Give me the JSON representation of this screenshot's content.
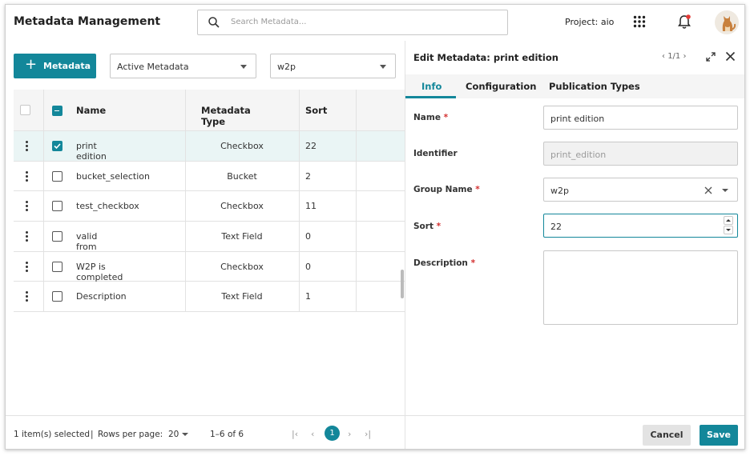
{
  "header": {
    "title": "Metadata Management",
    "search_placeholder": "Search Metadata...",
    "project": "Project: aio"
  },
  "toolbar": {
    "add_label": "Metadata",
    "filter_select": "Active Metadata",
    "group_select": "w2p"
  },
  "table": {
    "columns": [
      "Name",
      "Metadata Type",
      "Sort"
    ],
    "rows": [
      {
        "name": "print edition",
        "type": "Checkbox",
        "sort": "22",
        "checked": true
      },
      {
        "name": "bucket_selection",
        "type": "Bucket",
        "sort": "2",
        "checked": false
      },
      {
        "name": "test_checkbox",
        "type": "Checkbox",
        "sort": "11",
        "checked": false
      },
      {
        "name": "valid from",
        "type": "Text Field",
        "sort": "0",
        "checked": false
      },
      {
        "name": "W2P is completed",
        "type": "Checkbox",
        "sort": "0",
        "checked": false
      },
      {
        "name": "Description",
        "type": "Text Field",
        "sort": "1",
        "checked": false
      }
    ]
  },
  "footer": {
    "selected": "1 item(s) selected",
    "rows_per_page_label": "Rows per page:",
    "rows_per_page": "20",
    "range": "1–6 of 6",
    "page": "1"
  },
  "panel": {
    "title": "Edit Metadata: print edition",
    "nav": "1/1",
    "tabs": [
      "Info",
      "Configuration",
      "Publication Types"
    ],
    "fields": {
      "name_label": "Name",
      "name_value": "print edition",
      "identifier_label": "Identifier",
      "identifier_value": "print_edition",
      "group_label": "Group Name",
      "group_value": "w2p",
      "sort_label": "Sort",
      "sort_value": "22",
      "description_label": "Description",
      "description_value": ""
    },
    "required_mark": "*",
    "cancel_label": "Cancel",
    "save_label": "Save"
  },
  "colors": {
    "accent": "#13879a",
    "required": "#d32f2f"
  }
}
